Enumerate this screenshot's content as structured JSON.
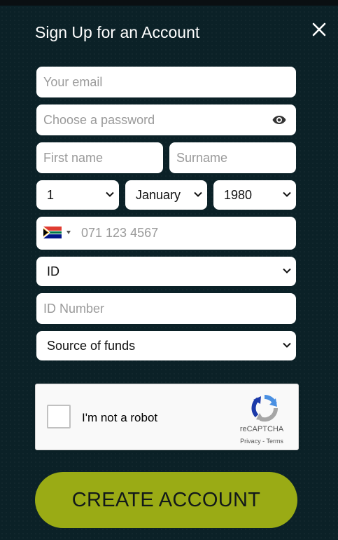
{
  "header": {
    "title": "Sign Up for an Account"
  },
  "form": {
    "email_placeholder": "Your email",
    "password_placeholder": "Choose a password",
    "first_name_placeholder": "First name",
    "surname_placeholder": "Surname",
    "dob": {
      "day": "1",
      "month": "January",
      "year": "1980"
    },
    "phone_placeholder": "071 123 4567",
    "id_type": "ID",
    "id_number_placeholder": "ID Number",
    "source_of_funds": "Source of funds"
  },
  "captcha": {
    "label": "I'm not a robot",
    "brand": "reCAPTCHA",
    "privacy": "Privacy",
    "separator": "-",
    "terms": "Terms"
  },
  "actions": {
    "create_account": "CREATE ACCOUNT"
  },
  "colors": {
    "background": "#0b2127",
    "accent_button": "#9aab15"
  }
}
